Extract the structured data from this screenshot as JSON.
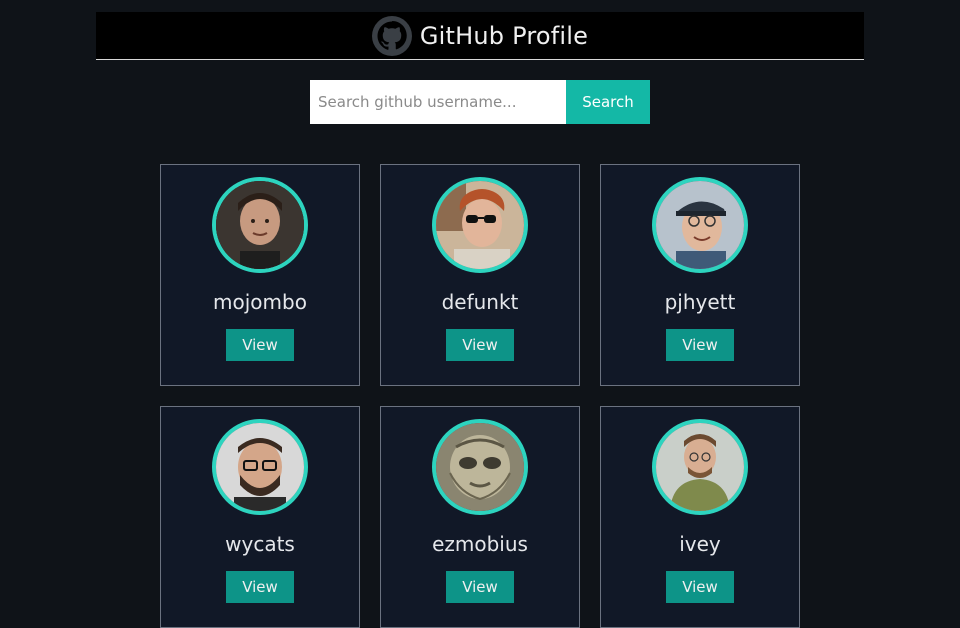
{
  "header": {
    "title": "GitHub Profile",
    "logo_icon": "github-octocat-icon"
  },
  "search": {
    "placeholder": "Search github username...",
    "value": "",
    "button_label": "Search"
  },
  "colors": {
    "accent": "#14b8a6",
    "avatar_ring": "#2dd4bf",
    "button": "#0d9488",
    "card_bg": "#111827",
    "page_bg": "#0f1318"
  },
  "users": [
    {
      "username": "mojombo",
      "view_label": "View"
    },
    {
      "username": "defunkt",
      "view_label": "View"
    },
    {
      "username": "pjhyett",
      "view_label": "View"
    },
    {
      "username": "wycats",
      "view_label": "View"
    },
    {
      "username": "ezmobius",
      "view_label": "View"
    },
    {
      "username": "ivey",
      "view_label": "View"
    }
  ]
}
